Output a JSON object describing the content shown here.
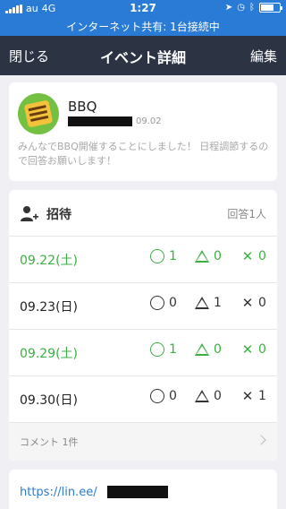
{
  "status_bar": {
    "carrier": "au",
    "network": "4G",
    "time": "1:27",
    "battery_level": 0.7
  },
  "hotspot_banner": "インターネット共有: 1台接続中",
  "nav": {
    "close_label": "閉じる",
    "title": "イベント詳細",
    "edit_label": "編集"
  },
  "event": {
    "title": "BBQ",
    "date": "09.02",
    "description": "みんなでBBQ開催することにしました！ 日程調節するので回答お願いします！"
  },
  "invitation": {
    "title": "招待",
    "response_count": "回答1人",
    "rows": [
      {
        "date": "09.22(土)",
        "ok": "1",
        "maybe": "0",
        "no": "0",
        "highlight": true
      },
      {
        "date": "09.23(日)",
        "ok": "0",
        "maybe": "1",
        "no": "0",
        "highlight": false
      },
      {
        "date": "09.29(土)",
        "ok": "1",
        "maybe": "0",
        "no": "0",
        "highlight": true
      },
      {
        "date": "09.30(日)",
        "ok": "0",
        "maybe": "0",
        "no": "1",
        "highlight": false
      }
    ],
    "comment_label": "コメント 1件"
  },
  "link": {
    "url_prefix": "https://lin.ee/"
  },
  "colors": {
    "status_blue": "#2a7bd5",
    "nav_dark": "#2c3444",
    "highlight_green": "#3cb043"
  }
}
